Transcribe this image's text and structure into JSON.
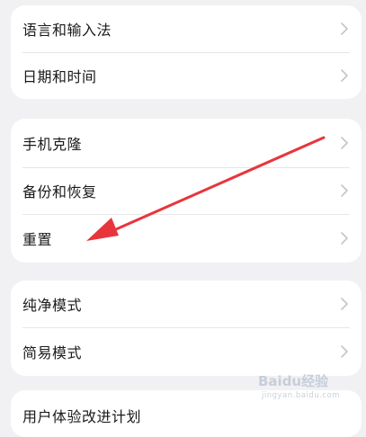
{
  "groups": [
    {
      "items": [
        {
          "label": "语言和输入法"
        },
        {
          "label": "日期和时间"
        }
      ]
    },
    {
      "items": [
        {
          "label": "手机克隆"
        },
        {
          "label": "备份和恢复"
        },
        {
          "label": "重置"
        }
      ]
    },
    {
      "items": [
        {
          "label": "纯净模式"
        },
        {
          "label": "简易模式"
        }
      ]
    },
    {
      "items": [
        {
          "label": "用户体验改进计划"
        }
      ]
    }
  ],
  "annotation": {
    "arrow_color": "#e8353c"
  },
  "watermark": {
    "logo_text": "Baidu经验",
    "sub_text": "jingyan.baidu.com"
  },
  "icons": {
    "chevron": "chevron-right-icon"
  }
}
